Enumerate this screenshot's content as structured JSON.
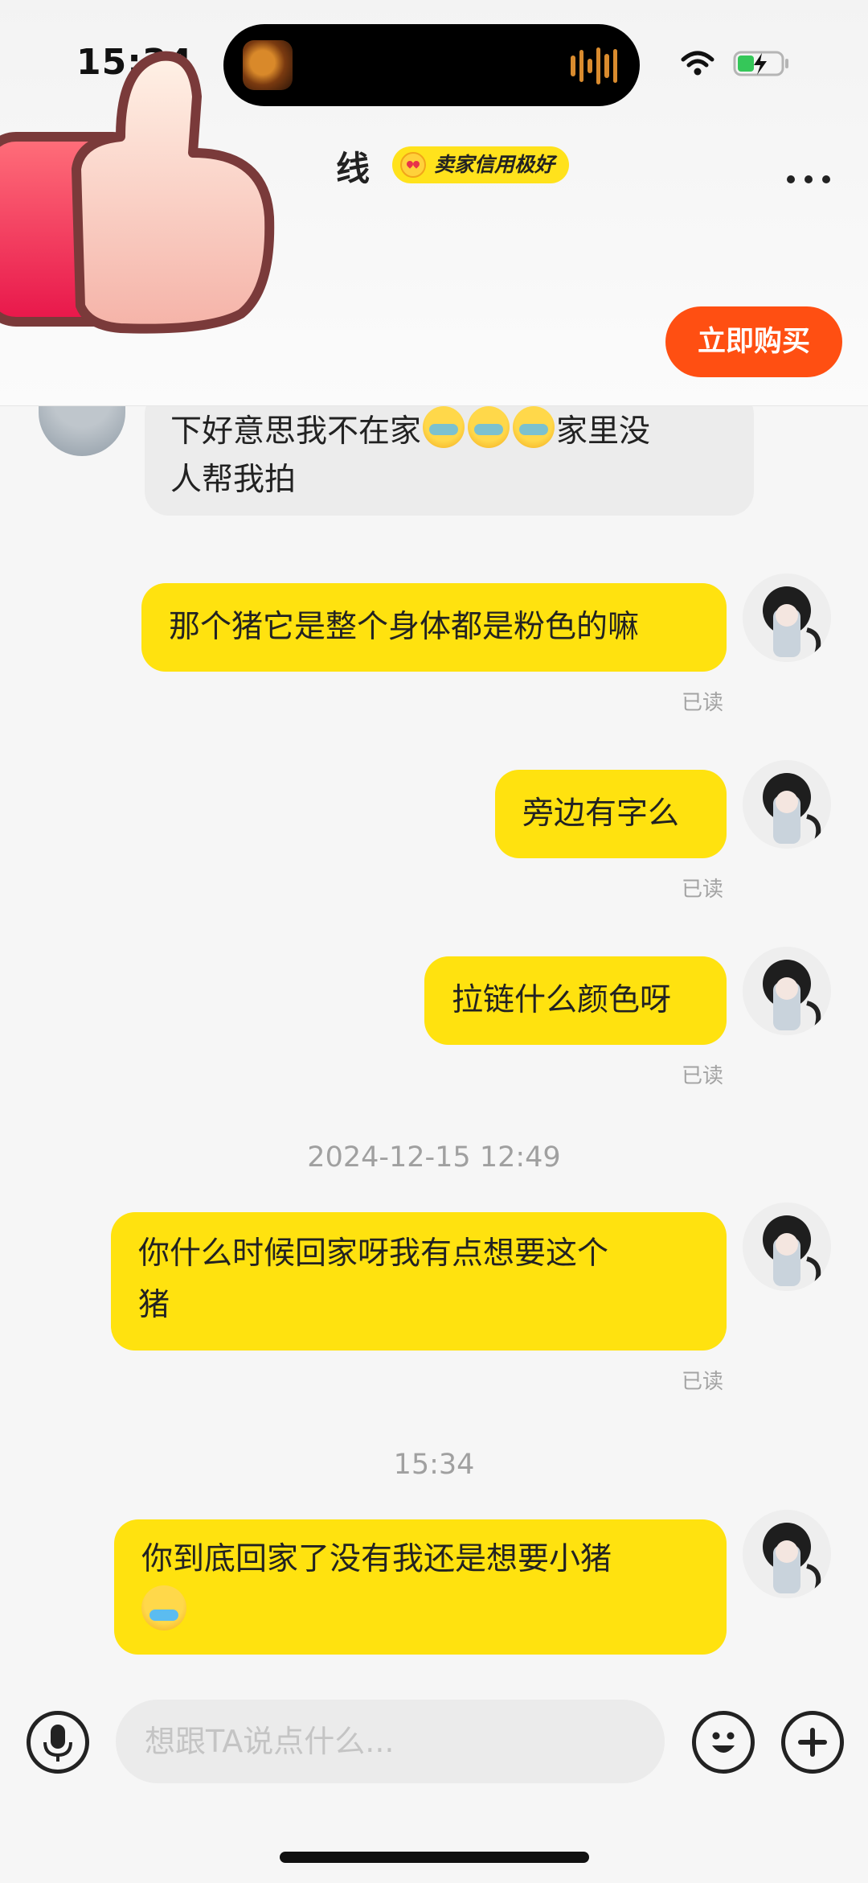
{
  "status_bar": {
    "time": "15:34"
  },
  "header": {
    "name_partial": "线",
    "credit_badge": "卖家信用极好",
    "buy_button": "立即购买",
    "more_icon": "more-horizontal-icon"
  },
  "messages": {
    "incoming_line1_a": "下好意思我不在家",
    "incoming_line1_b": "家里没",
    "incoming_line2": "人帮我拍",
    "m1": "那个猪它是整个身体都是粉色的嘛",
    "m2": "旁边有字么",
    "m3": "拉链什么颜色呀",
    "time1": "2024-12-15 12:49",
    "m4_line1": "你什么时候回家呀我有点想要这个",
    "m4_line2": "猪",
    "time2": "15:34",
    "m5_line1": "你到底回家了没有我还是想要小猪",
    "read_label": "已读"
  },
  "input": {
    "placeholder": "想跟TA说点什么..."
  },
  "colors": {
    "bubble_out": "#ffe20f",
    "buy": "#ff4f12",
    "badge": "#ffe21c"
  }
}
